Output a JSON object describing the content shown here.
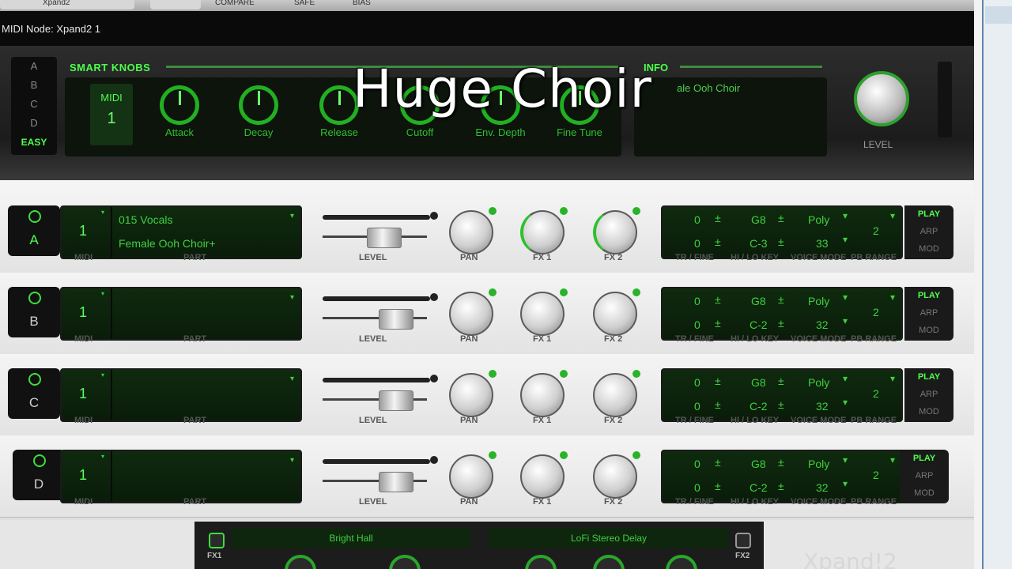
{
  "host": {
    "tabs": [
      "Xpand2",
      "COMPARE",
      "SAFE",
      "BIAS"
    ],
    "title": "MIDI Node: Xpand2 1"
  },
  "smart_knobs": {
    "parts": [
      "A",
      "B",
      "C",
      "D"
    ],
    "easy_label": "EASY",
    "title": "SMART KNOBS",
    "midi_label": "MIDI",
    "midi_value": "1",
    "knobs": [
      "Attack",
      "Decay",
      "Release",
      "Cutoff",
      "Env. Depth",
      "Fine Tune"
    ]
  },
  "info": {
    "title": "INFO",
    "text": "ale Ooh Choir"
  },
  "master": {
    "level_label": "LEVEL"
  },
  "overlay_caption": "Huge Choir",
  "row_labels": {
    "midi": "MIDI",
    "part": "PART",
    "level": "LEVEL",
    "pan": "PAN",
    "fx1": "FX 1",
    "fx2": "FX 2",
    "tr_fine": "TR / FINE",
    "hi_lo_key": "HI / LO KEY",
    "voice_mode": "VOICE MODE",
    "pb_range": "PB RANGE"
  },
  "modes": [
    "PLAY",
    "ARP",
    "MOD"
  ],
  "rows": [
    {
      "letter": "A",
      "midi": "1",
      "patch_line1": "015 Vocals",
      "patch_line2": "Female Ooh Choir+",
      "tr": "0",
      "fine": "0",
      "hi_key": "G8",
      "lo_key": "C-3",
      "voice_mode": "Poly",
      "voices": "33",
      "pb_range": "2",
      "fader": 0.4
    },
    {
      "letter": "B",
      "midi": "1",
      "patch_line1": "",
      "patch_line2": "",
      "tr": "0",
      "fine": "0",
      "hi_key": "G8",
      "lo_key": "C-2",
      "voice_mode": "Poly",
      "voices": "32",
      "pb_range": "2",
      "fader": 0.65
    },
    {
      "letter": "C",
      "midi": "1",
      "patch_line1": "",
      "patch_line2": "",
      "tr": "0",
      "fine": "0",
      "hi_key": "G8",
      "lo_key": "C-2",
      "voice_mode": "Poly",
      "voices": "32",
      "pb_range": "2",
      "fader": 0.65
    },
    {
      "letter": "D",
      "midi": "1",
      "patch_line1": "",
      "patch_line2": "",
      "tr": "0",
      "fine": "0",
      "hi_key": "G8",
      "lo_key": "C-2",
      "voice_mode": "Poly",
      "voices": "32",
      "pb_range": "2",
      "fader": 0.65
    }
  ],
  "fx": {
    "fx1_label": "FX1",
    "fx1_name": "Bright Hall",
    "fx2_label": "FX2",
    "fx2_name": "LoFi Stereo Delay"
  },
  "brand": "Xpand!2",
  "colors": {
    "accent": "#4cff4c",
    "lcd": "#0f2a0f"
  }
}
